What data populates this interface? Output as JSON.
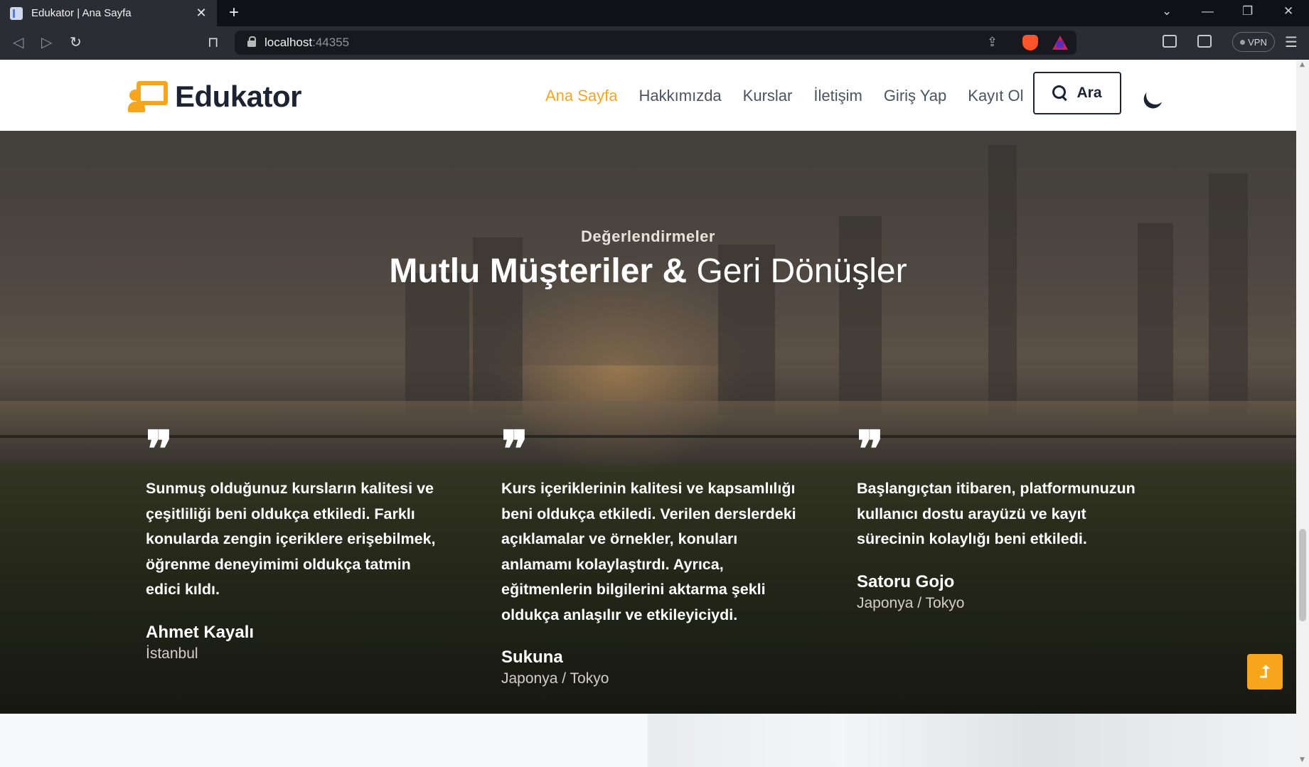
{
  "browser": {
    "tab_title": "Edukator | Ana Sayfa",
    "tab_close": "✕",
    "new_tab": "+",
    "url_host": "localhost",
    "url_port": ":44355",
    "vpn_label": "VPN",
    "icons": [
      "back-icon",
      "forward-icon",
      "reload-icon",
      "bookmark-icon",
      "lock-icon",
      "share-icon",
      "brave-shields-icon",
      "brave-rewards-icon",
      "sidebar-icon",
      "wallet-icon",
      "menu-icon"
    ]
  },
  "header": {
    "logo_text": "Edukator",
    "nav": [
      {
        "label": "Ana Sayfa",
        "active": true
      },
      {
        "label": "Hakkımızda",
        "active": false
      },
      {
        "label": "Kurslar",
        "active": false
      },
      {
        "label": "İletişim",
        "active": false
      },
      {
        "label": "Giriş Yap",
        "active": false
      },
      {
        "label": "Kayıt Ol",
        "active": false
      }
    ],
    "search_label": "Ara",
    "accent_color": "#f7a51b"
  },
  "testimonials": {
    "subtitle": "Değerlendirmeler",
    "title_bold": "Mutlu Müşteriler &",
    "title_light": "Geri Dönüşler",
    "quote_glyph": "❞",
    "items": [
      {
        "text": "Sunmuş olduğunuz kursların kalitesi ve çeşitliliği beni oldukça etkiledi. Farklı konularda zengin içeriklere erişebilmek, öğrenme deneyimimi oldukça tatmin edici kıldı.",
        "name": "Ahmet Kayalı",
        "location": "İstanbul"
      },
      {
        "text": "Kurs içeriklerinin kalitesi ve kapsamlılığı beni oldukça etkiledi. Verilen derslerdeki açıklamalar ve örnekler, konuları anlamamı kolaylaştırdı. Ayrıca, eğitmenlerin bilgilerini aktarma şekli oldukça anlaşılır ve etkileyiciydi.",
        "name": "Sukuna",
        "location": "Japonya / Tokyo"
      },
      {
        "text": "Başlangıçtan itibaren, platformunuzun kullanıcı dostu arayüzü ve kayıt sürecinin kolaylığı beni etkiledi.",
        "name": "Satoru Gojo",
        "location": "Japonya / Tokyo"
      }
    ]
  },
  "back_to_top_glyph": "⮥"
}
